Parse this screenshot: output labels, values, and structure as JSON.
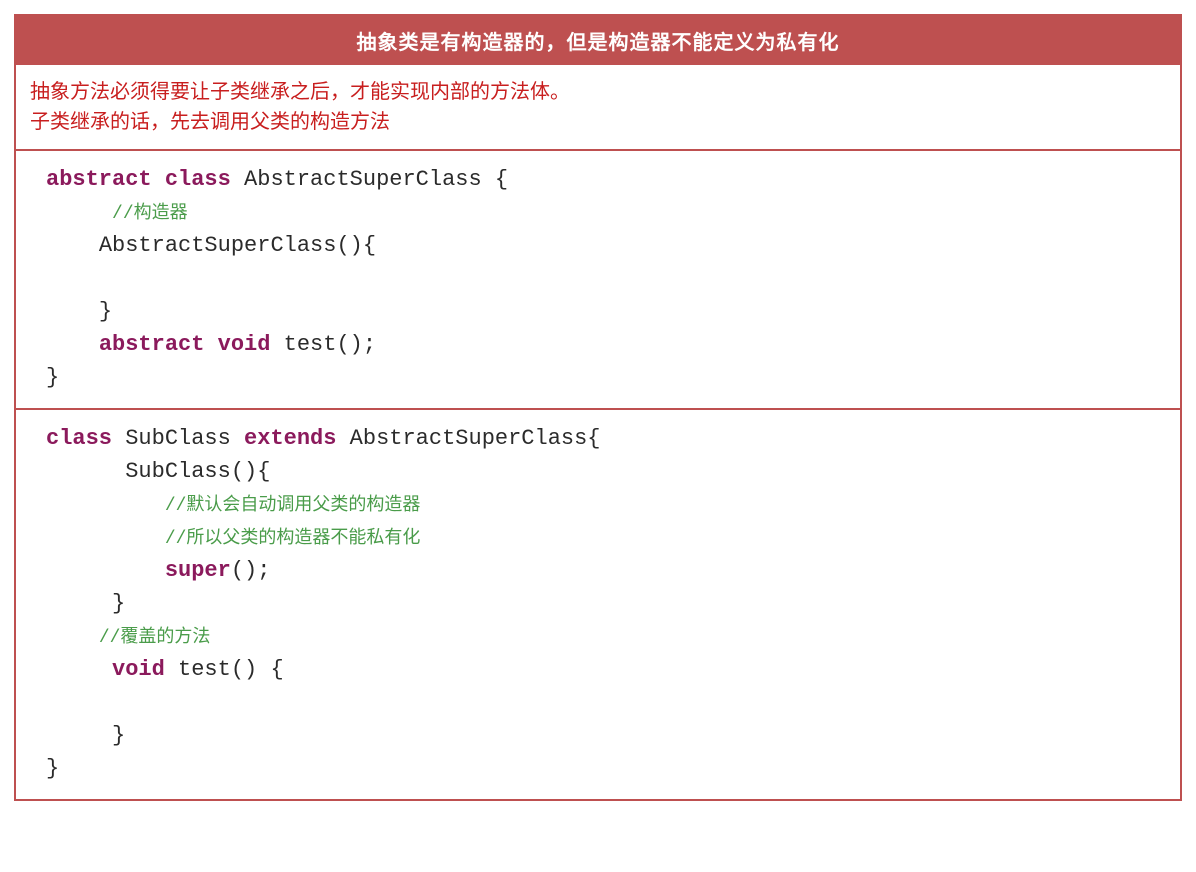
{
  "header": {
    "title": "抽象类是有构造器的，但是构造器不能定义为私有化"
  },
  "description": {
    "line1": "抽象方法必须得要让子类继承之后，才能实现内部的方法体。",
    "line2": "子类继承的话，先去调用父类的构造方法"
  },
  "code1": {
    "kw_abstract": "abstract",
    "kw_class": "class",
    "class_name": " AbstractSuperClass {",
    "comment1": "//构造器",
    "constructor": "AbstractSuperClass(){",
    "close1": "}",
    "kw_abstract2": "abstract",
    "kw_void": "void",
    "method": " test();",
    "close2": "}"
  },
  "code2": {
    "kw_class": "class",
    "class_name": " SubClass ",
    "kw_extends": "extends",
    "parent": " AbstractSuperClass{",
    "constructor": "SubClass(){",
    "comment1": "//默认会自动调用父类的构造器",
    "comment2": "//所以父类的构造器不能私有化",
    "super_call": "super",
    "super_end": "();",
    "close1": "}",
    "comment3": "//覆盖的方法",
    "kw_void": "void",
    "method": " test() {",
    "close2": "}",
    "close3": "}"
  }
}
